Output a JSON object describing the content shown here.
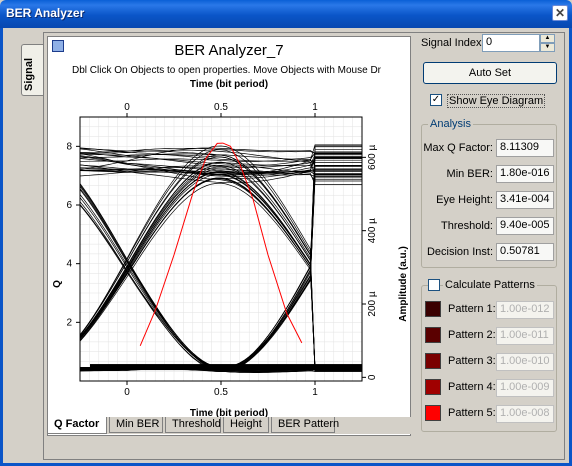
{
  "window": {
    "title": "BER Analyzer"
  },
  "side_tab": {
    "label": "Signal"
  },
  "graph": {
    "title": "BER Analyzer_7",
    "subtitle": "Dbl Click On Objects to open properties.  Move Objects with Mouse Dr",
    "tabs": [
      "Q Factor",
      "Min BER",
      "Threshold",
      "Height",
      "BER Pattern"
    ],
    "active_tab": "Q Factor"
  },
  "controls": {
    "signal_index_label": "Signal Index:",
    "signal_index_value": "0",
    "auto_set_label": "Auto Set",
    "show_eye_label": "Show Eye Diagram",
    "show_eye_checked": true
  },
  "analysis": {
    "title": "Analysis",
    "rows": [
      {
        "label": "Max Q Factor:",
        "value": "8.11309"
      },
      {
        "label": "Min BER:",
        "value": "1.80e-016"
      },
      {
        "label": "Eye Height:",
        "value": "3.41e-004"
      },
      {
        "label": "Threshold:",
        "value": "9.40e-005"
      },
      {
        "label": "Decision Inst:",
        "value": "0.50781"
      }
    ]
  },
  "patterns": {
    "title": "Calculate Patterns",
    "checked": false,
    "items": [
      {
        "label": "Pattern 1:",
        "value": "1.00e-012",
        "color": "#3a0000"
      },
      {
        "label": "Pattern 2:",
        "value": "1.00e-011",
        "color": "#5a0000"
      },
      {
        "label": "Pattern 3:",
        "value": "1.00e-010",
        "color": "#7a0000"
      },
      {
        "label": "Pattern 4:",
        "value": "1.00e-009",
        "color": "#a00000"
      },
      {
        "label": "Pattern 5:",
        "value": "1.00e-008",
        "color": "#ff0000"
      }
    ]
  },
  "chart_data": {
    "type": "line",
    "title": "BER Analyzer_7",
    "xlabel": "Time (bit period)",
    "x2label": "Time (bit period)",
    "ylabel": "Q",
    "y2label": "Amplitude (a.u.)",
    "xlim": [
      -0.25,
      1.25
    ],
    "ylim": [
      0,
      9
    ],
    "y2lim": [
      -1e-05,
      0.00071
    ],
    "x_ticks": [
      "0",
      "0.5",
      "1"
    ],
    "y_ticks": [
      "2",
      "4",
      "6",
      "8"
    ],
    "y2_ticks": [
      "0",
      "200 µ",
      "400 µ",
      "600 µ"
    ],
    "grid": true,
    "series": [
      {
        "name": "Q Factor",
        "color": "#ff0000",
        "x": [
          0.07,
          0.15,
          0.25,
          0.35,
          0.42,
          0.48,
          0.51,
          0.55,
          0.6,
          0.67,
          0.75,
          0.85,
          0.93
        ],
        "y": [
          1.2,
          2.4,
          4.3,
          6.4,
          7.6,
          8.1,
          8.11,
          8.0,
          7.4,
          6.2,
          4.3,
          2.3,
          1.3
        ]
      }
    ]
  }
}
